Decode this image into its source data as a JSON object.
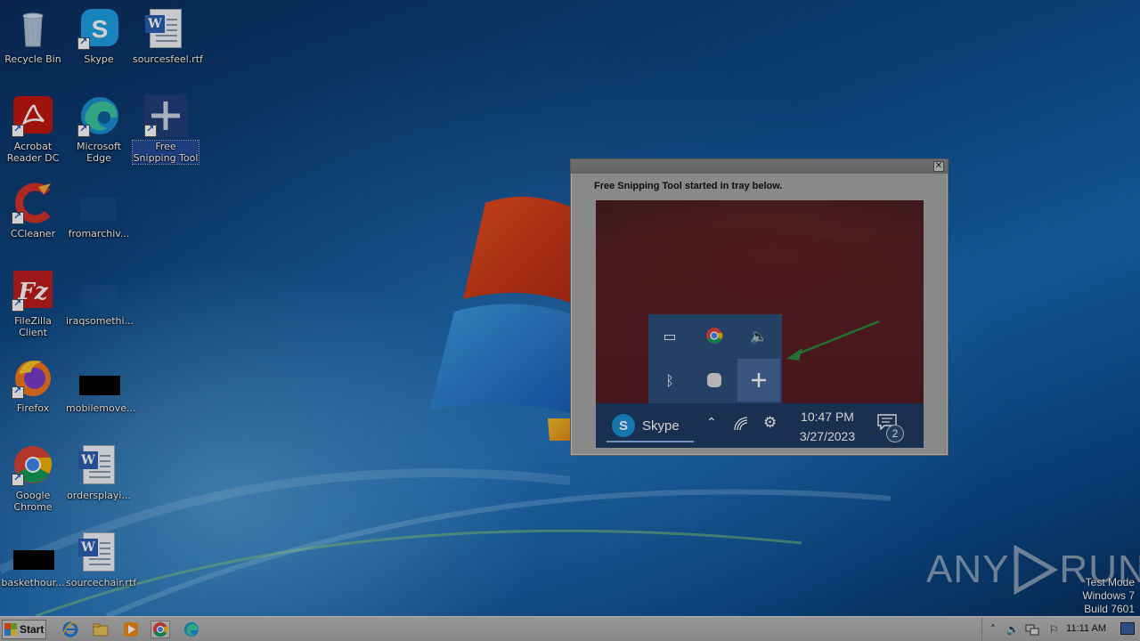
{
  "desktop": {
    "icons": [
      {
        "label": "Recycle Bin",
        "icon": "recycle-bin-icon"
      },
      {
        "label": "Skype",
        "icon": "skype-icon"
      },
      {
        "label": "sourcesfeel.rtf",
        "icon": "word-document-icon"
      },
      {
        "label": "Acrobat Reader DC",
        "icon": "acrobat-reader-icon"
      },
      {
        "label": "Microsoft Edge",
        "icon": "edge-icon"
      },
      {
        "label": "Free Snipping Tool",
        "icon": "free-snipping-tool-icon"
      },
      {
        "label": "CCleaner",
        "icon": "ccleaner-icon"
      },
      {
        "label": "fromarchiv...",
        "icon": "file-icon"
      },
      {
        "label": "FileZilla Client",
        "icon": "filezilla-icon"
      },
      {
        "label": "iraqsomethi...",
        "icon": "file-icon"
      },
      {
        "label": "Firefox",
        "icon": "firefox-icon"
      },
      {
        "label": "mobilemove...",
        "icon": "file-icon"
      },
      {
        "label": "Google Chrome",
        "icon": "chrome-icon"
      },
      {
        "label": "ordersplayi...",
        "icon": "word-document-icon"
      },
      {
        "label": "baskethour...",
        "icon": "file-icon"
      },
      {
        "label": "sourcechair.rtf",
        "icon": "word-document-icon"
      }
    ]
  },
  "popup": {
    "close_label": "✕",
    "message": "Free Snipping Tool started in tray below.",
    "screenshot": {
      "skype_label": "Skype",
      "skype_letter": "S",
      "time": "10:47 PM",
      "date": "3/27/2023",
      "notification_count": "2"
    }
  },
  "watermark": {
    "text_a": "ANY",
    "text_b": "RUN"
  },
  "test_mode": {
    "line1": "Test Mode",
    "line2": "Windows 7",
    "line3": "Build 7601"
  },
  "taskbar": {
    "start_label": "Start",
    "pinned": [
      "internet-explorer-icon",
      "file-explorer-icon",
      "media-player-icon",
      "chrome-icon",
      "edge-icon"
    ],
    "clock": "11:11 AM"
  },
  "colors": {
    "accent": "#1767b2",
    "taskbar": "#b0b0b0",
    "popup_bg": "#a8a8a8"
  }
}
